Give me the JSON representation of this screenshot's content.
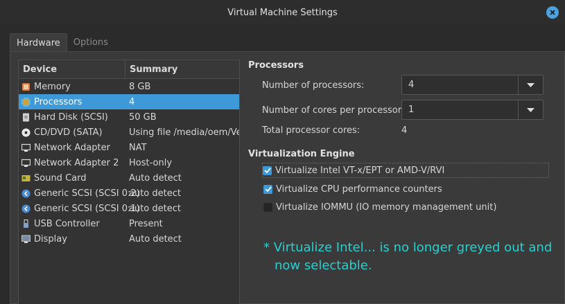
{
  "window": {
    "title": "Virtual Machine Settings",
    "close_icon": "close-icon"
  },
  "tabs": [
    {
      "label": "Hardware",
      "active": true
    },
    {
      "label": "Options",
      "active": false
    }
  ],
  "device_list": {
    "headers": {
      "device": "Device",
      "summary": "Summary"
    },
    "rows": [
      {
        "device": "Memory",
        "summary": "8 GB",
        "icon": "memory-icon"
      },
      {
        "device": "Processors",
        "summary": "4",
        "icon": "cpu-icon",
        "selected": true
      },
      {
        "device": "Hard Disk (SCSI)",
        "summary": "50 GB",
        "icon": "hard-disk-icon"
      },
      {
        "device": "CD/DVD (SATA)",
        "summary": "Using file /media/oem/Ven",
        "icon": "cd-icon"
      },
      {
        "device": "Network Adapter",
        "summary": "NAT",
        "icon": "network-icon"
      },
      {
        "device": "Network Adapter 2",
        "summary": "Host-only",
        "icon": "network-icon"
      },
      {
        "device": "Sound Card",
        "summary": "Auto detect",
        "icon": "sound-card-icon"
      },
      {
        "device": "Generic SCSI (SCSI 0:2)",
        "summary": "auto detect",
        "icon": "scsi-icon"
      },
      {
        "device": "Generic SCSI (SCSI 0:1)",
        "summary": "auto detect",
        "icon": "scsi-icon"
      },
      {
        "device": "USB Controller",
        "summary": "Present",
        "icon": "usb-icon"
      },
      {
        "device": "Display",
        "summary": "Auto detect",
        "icon": "display-icon"
      }
    ]
  },
  "processors": {
    "title": "Processors",
    "num_processors_label": "Number of processors:",
    "num_processors_value": "4",
    "cores_label": "Number of cores per processor:",
    "cores_value": "1",
    "total_label": "Total processor cores:",
    "total_value": "4"
  },
  "virtualization": {
    "title": "Virtualization Engine",
    "options": [
      {
        "label": "Virtualize Intel VT-x/EPT or AMD-V/RVI",
        "checked": true
      },
      {
        "label": "Virtualize CPU performance counters",
        "checked": true
      },
      {
        "label": "Virtualize IOMMU (IO memory management unit)",
        "checked": false
      }
    ]
  },
  "annotation": {
    "line1": "* Virtualize Intel... is no longer greyed out and",
    "line2": "now selectable.",
    "color": "#25d1d1"
  },
  "colors": {
    "accent": "#3d99d8",
    "background": "#2b2b2b",
    "panel": "#3a3a3a"
  }
}
